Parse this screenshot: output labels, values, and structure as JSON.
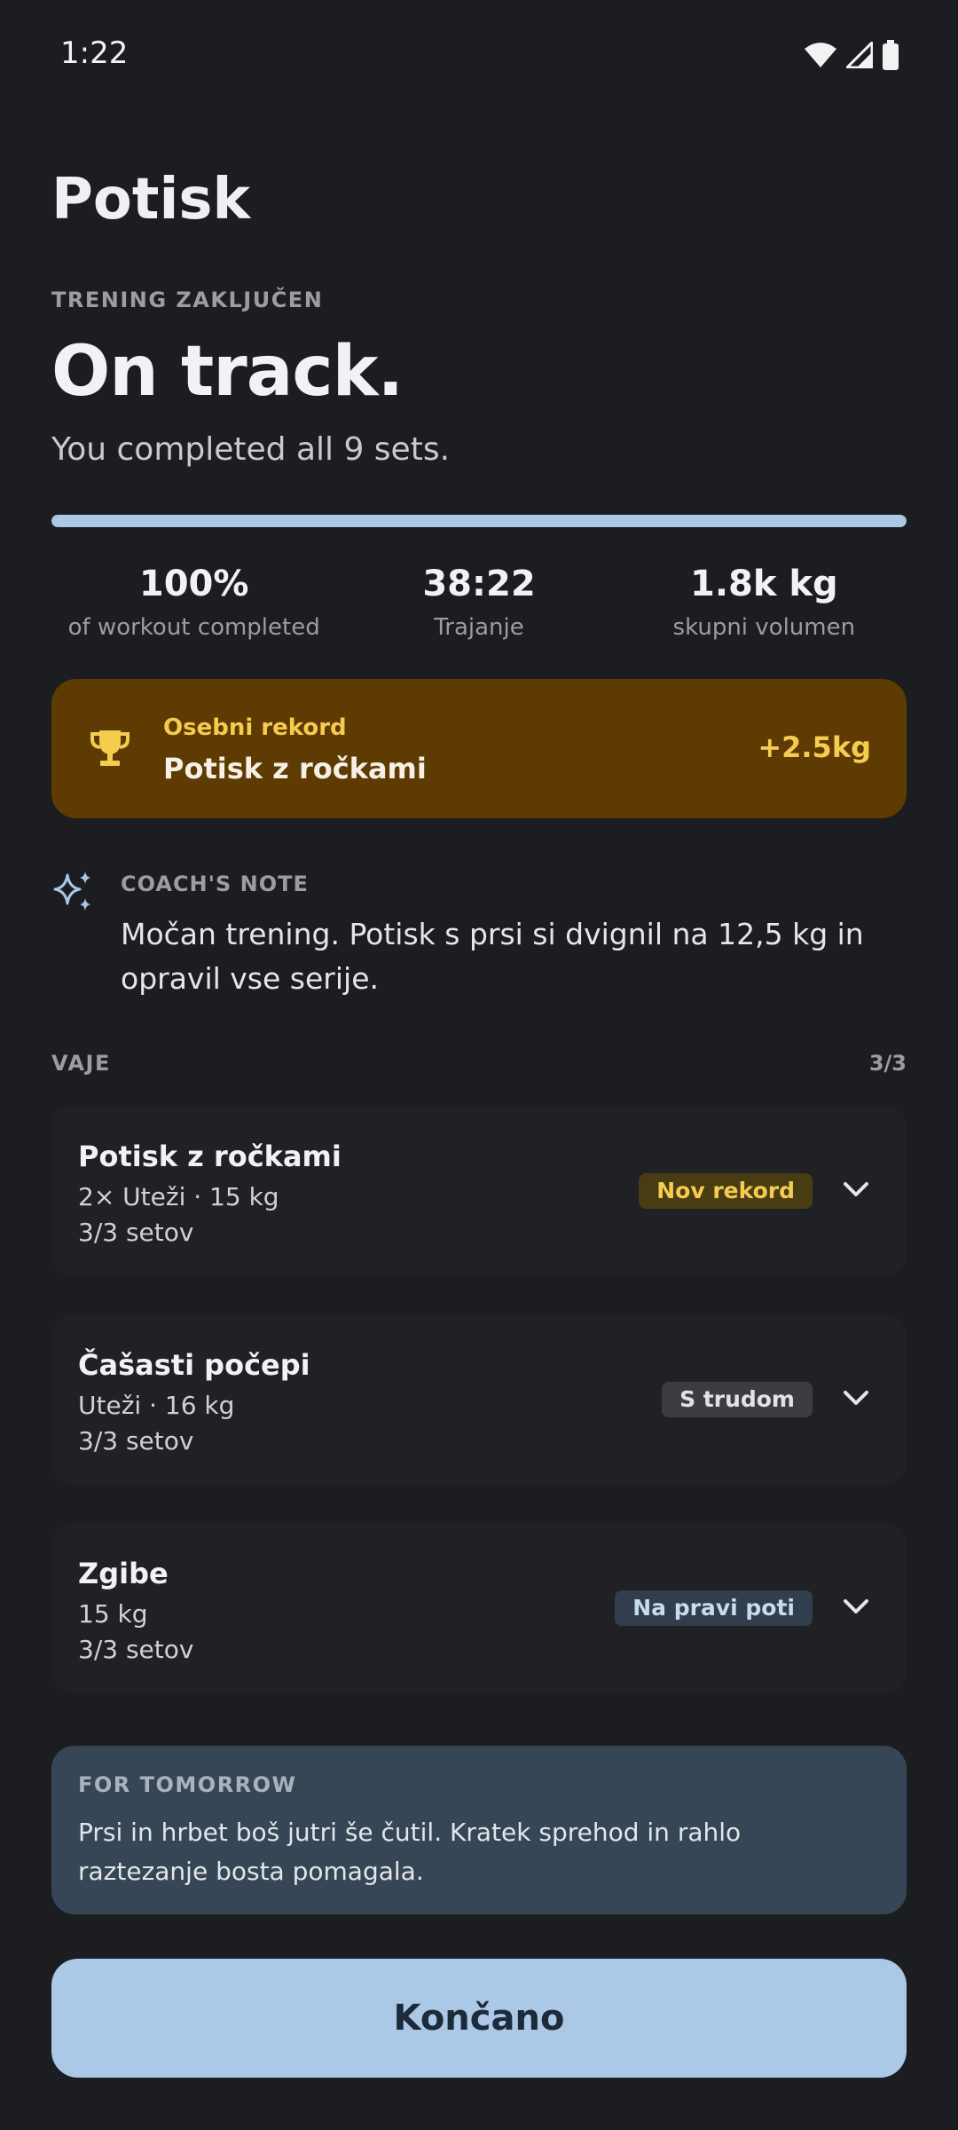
{
  "status_bar": {
    "time": "1:22",
    "icons": [
      "wifi-icon",
      "signal-icon",
      "battery-icon"
    ]
  },
  "page_title": "Potisk",
  "summary": {
    "eyebrow": "TRENING ZAKLJUČEN",
    "headline": "On track.",
    "subline": "You completed all 9 sets.",
    "progress_fraction": 1.0
  },
  "stats": [
    {
      "value": "100%",
      "label": "of workout completed"
    },
    {
      "value": "38:22",
      "label": "Trajanje"
    },
    {
      "value": "1.8k kg",
      "label": "skupni volumen"
    }
  ],
  "record": {
    "icon": "trophy-icon",
    "kicker": "Osebni rekord",
    "exercise": "Potisk z ročkami",
    "delta": "+2.5kg"
  },
  "coach": {
    "icon": "sparkle-icon",
    "kicker": "COACH'S NOTE",
    "text": "Močan trening. Potisk s prsi si dvignil na 12,5 kg in opravil vse serije."
  },
  "exercises_section": {
    "title": "VAJE",
    "count": "3/3"
  },
  "exercises": [
    {
      "name": "Potisk z ročkami",
      "detail": "2× Uteži · 15 kg",
      "sets": "3/3 setov",
      "badge": "Nov rekord"
    },
    {
      "name": "Čašasti počepi",
      "detail": "Uteži · 16 kg",
      "sets": "3/3 setov",
      "badge": "S trudom"
    },
    {
      "name": "Zgibe",
      "detail": "15 kg",
      "sets": "3/3 setov",
      "badge": "Na pravi poti"
    }
  ],
  "tomorrow": {
    "kicker": "FOR TOMORROW",
    "text": "Prsi in hrbet boš jutri še čutil. Kratek sprehod in rahlo raztezanje bosta pomagala."
  },
  "done_button": "Končano",
  "colors": {
    "background": "#1c1d21",
    "accent": "#abc8e6",
    "record_bg": "#5e3b03",
    "record_accent": "#f5cc4e",
    "tomorrow_bg": "#364656"
  }
}
